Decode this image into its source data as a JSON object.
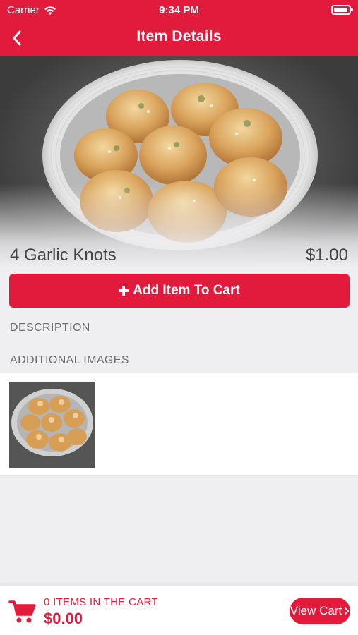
{
  "status_bar": {
    "carrier": "Carrier",
    "time": "9:34 PM"
  },
  "nav": {
    "title": "Item Details",
    "back_icon": "chevron-left-icon"
  },
  "item": {
    "name": "4 Garlic Knots",
    "price": "$1.00"
  },
  "add_button": {
    "label": "Add Item To Cart",
    "icon": "plus-icon"
  },
  "sections": {
    "description": "DESCRIPTION",
    "additional_images": "ADDITIONAL IMAGES"
  },
  "cart": {
    "count_text": "0 ITEMS IN THE CART",
    "total": "$0.00",
    "view_cart_label": "View Cart",
    "icon": "cart-icon"
  },
  "colors": {
    "accent": "#e21b3c",
    "background": "#efeff1"
  }
}
